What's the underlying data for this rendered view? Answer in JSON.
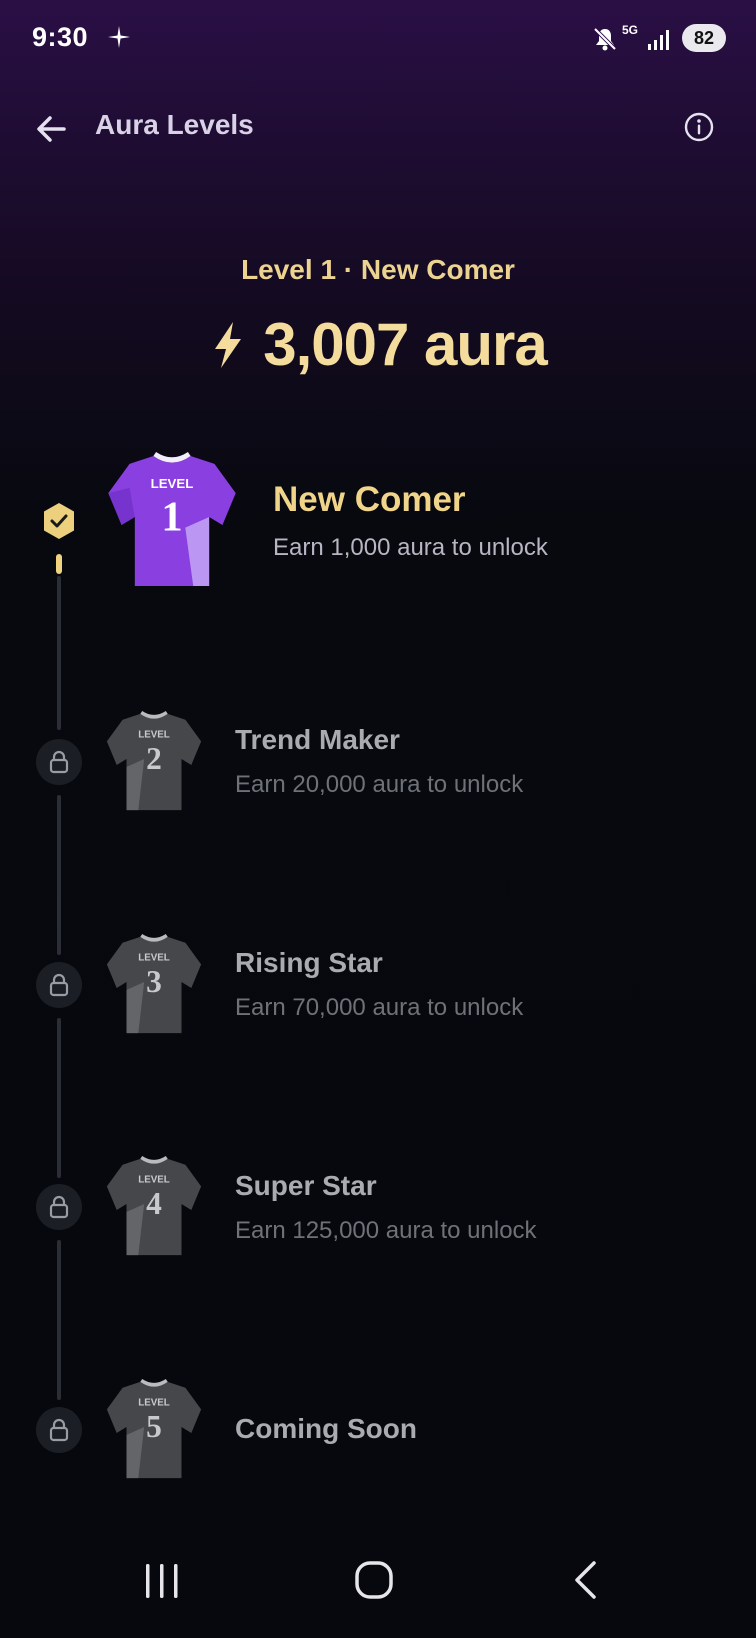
{
  "status_bar": {
    "time": "9:30",
    "network": "5G",
    "battery": "82",
    "icons": [
      "spark-icon",
      "mute-icon",
      "signal-icon",
      "battery-icon"
    ]
  },
  "header": {
    "title": "Aura Levels",
    "back_icon": "arrow-left-icon",
    "info_icon": "info-icon"
  },
  "summary": {
    "caption": "Level 1 · New Comer",
    "aura_total": "3,007 aura",
    "icon": "lightning-bolt-icon"
  },
  "levels": [
    {
      "number": "1",
      "jersey_label": "LEVEL",
      "title": "New Comer",
      "subtitle": "Earn 1,000 aura to unlock",
      "state": "unlocked"
    },
    {
      "number": "2",
      "jersey_label": "LEVEL",
      "title": "Trend Maker",
      "subtitle": "Earn 20,000 aura to unlock",
      "state": "locked"
    },
    {
      "number": "3",
      "jersey_label": "LEVEL",
      "title": "Rising Star",
      "subtitle": "Earn 70,000 aura to unlock",
      "state": "locked"
    },
    {
      "number": "4",
      "jersey_label": "LEVEL",
      "title": "Super Star",
      "subtitle": "Earn 125,000 aura to unlock",
      "state": "locked"
    },
    {
      "number": "5",
      "jersey_label": "LEVEL",
      "title": "Coming Soon",
      "subtitle": "",
      "state": "locked"
    }
  ],
  "colors": {
    "accent_gold": "#f0d48a",
    "unlocked_jersey": "#8a3fe0",
    "locked_jersey": "#4a4c50"
  },
  "nav_bar": {
    "icons": [
      "recents-icon",
      "home-icon",
      "back-icon"
    ]
  }
}
